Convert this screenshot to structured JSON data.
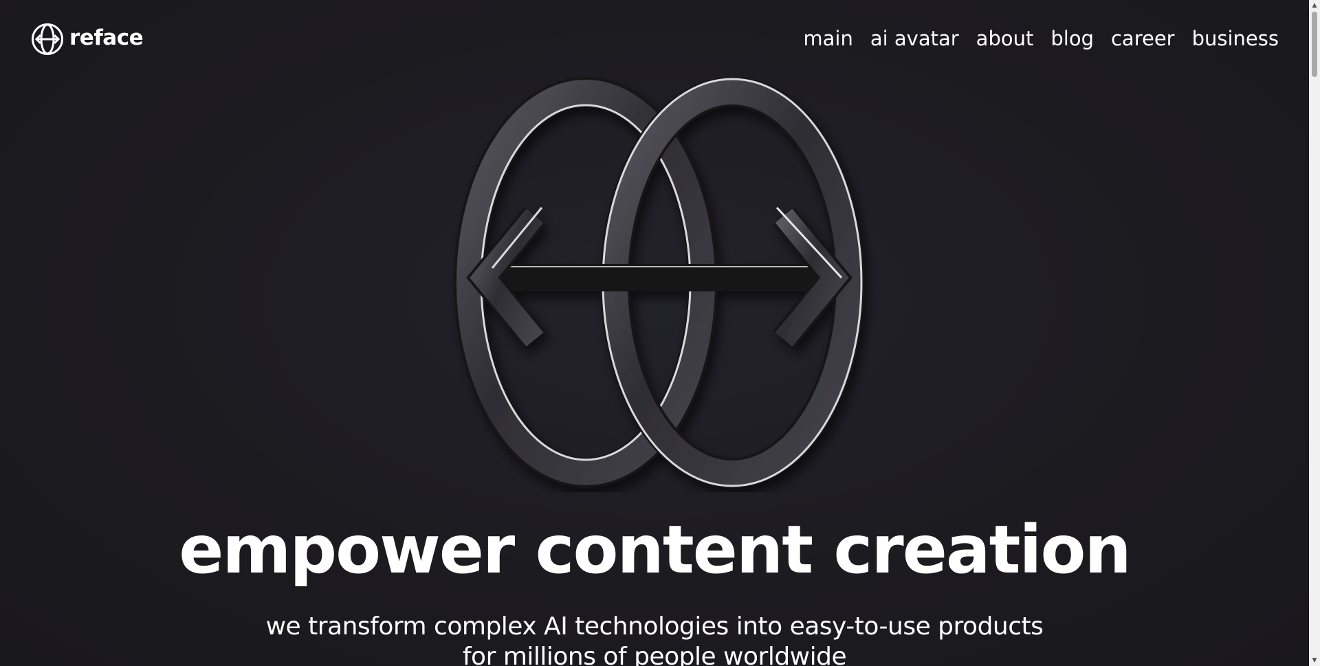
{
  "brand": {
    "name": "reface",
    "logo_icon": "reface-logo-icon"
  },
  "nav": {
    "items": [
      {
        "label": "main"
      },
      {
        "label": "ai avatar"
      },
      {
        "label": "about"
      },
      {
        "label": "blog"
      },
      {
        "label": "career"
      },
      {
        "label": "business"
      }
    ]
  },
  "hero": {
    "emblem_icon": "reface-3d-emblem-icon",
    "headline": "empower content creation",
    "subline_1": "we transform complex AI technologies into easy-to-use products",
    "subline_2": "for millions of people worldwide"
  },
  "colors": {
    "background": "#1c1b20",
    "text": "#ffffff",
    "emblem_metal": "#3a393f"
  }
}
